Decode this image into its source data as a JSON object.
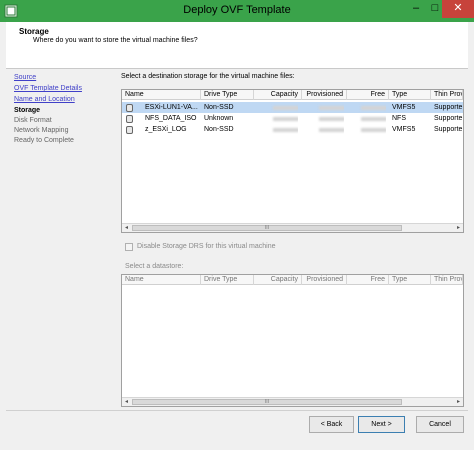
{
  "window": {
    "title": "Deploy OVF Template",
    "minimize_glyph": "–",
    "maximize_glyph": "□",
    "close_glyph": "✕",
    "accent": "#3aa34a"
  },
  "header": {
    "title": "Storage",
    "subtitle": "Where do you want to store the virtual machine files?"
  },
  "sidebar": {
    "items": [
      {
        "label": "Source",
        "state": "link"
      },
      {
        "label": "OVF Template Details",
        "state": "link"
      },
      {
        "label": "Name and Location",
        "state": "link"
      },
      {
        "label": "Storage",
        "state": "current"
      },
      {
        "label": "Disk Format",
        "state": "disabled"
      },
      {
        "label": "Network Mapping",
        "state": "disabled"
      },
      {
        "label": "Ready to Complete",
        "state": "disabled"
      }
    ]
  },
  "main": {
    "select_label": "Select a destination storage for the virtual machine files:",
    "storage_table": {
      "columns": [
        "Name",
        "Drive Type",
        "Capacity",
        "Provisioned",
        "Free",
        "Type",
        "Thin Prov"
      ],
      "rows": [
        {
          "name": "ESXi-LUN1-VA...",
          "drive_type": "Non-SSD",
          "type": "VMFS5",
          "thin": "Supporte",
          "selected": true
        },
        {
          "name": "NFS_DATA_ISO",
          "drive_type": "Unknown",
          "type": "NFS",
          "thin": "Supporte",
          "selected": false
        },
        {
          "name": "z_ESXi_LOG",
          "drive_type": "Non-SSD",
          "type": "VMFS5",
          "thin": "Supporte",
          "selected": false
        }
      ],
      "scroll_left": "◂",
      "scroll_right": "▸",
      "scroll_grip": "III"
    },
    "drs_checkbox_label": "Disable Storage DRS for this virtual machine",
    "datastore_label": "Select a datastore:",
    "datastore_table": {
      "columns": [
        "Name",
        "Drive Type",
        "Capacity",
        "Provisioned",
        "Free",
        "Type",
        "Thin Prov"
      ],
      "scroll_left": "◂",
      "scroll_right": "▸",
      "scroll_grip": "III"
    }
  },
  "footer": {
    "back_label": "< Back",
    "next_label": "Next >",
    "cancel_label": "Cancel"
  }
}
